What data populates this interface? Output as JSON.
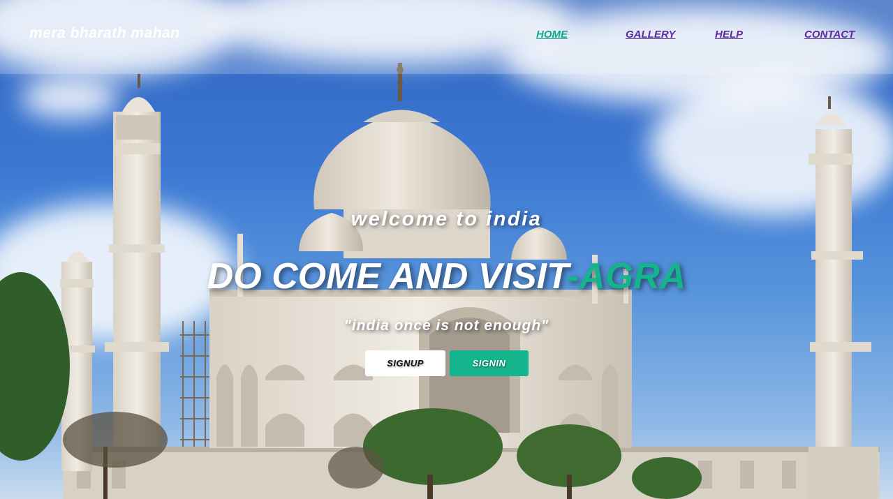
{
  "header": {
    "logo": "mera bharath mahan",
    "nav": [
      {
        "label": "HOME",
        "color": "#0fa98a",
        "active": true
      },
      {
        "label": "GALLERY",
        "color": "#5b2a9c",
        "active": false
      },
      {
        "label": "HELP",
        "color": "#5b2a9c",
        "active": false
      },
      {
        "label": "CONTACT",
        "color": "#5b2a9c",
        "active": false
      }
    ]
  },
  "hero": {
    "welcome": "welcome to india",
    "title_main": "DO COME AND VISIT",
    "title_sep": "-",
    "title_accent": "AGRA",
    "tagline": "\"india once is not enough\"",
    "accent_color": "#14b48c"
  },
  "actions": {
    "signup_label": "SIGNUP",
    "signin_label": "SIGNIN"
  },
  "background": {
    "subject": "taj-mahal-photo"
  }
}
